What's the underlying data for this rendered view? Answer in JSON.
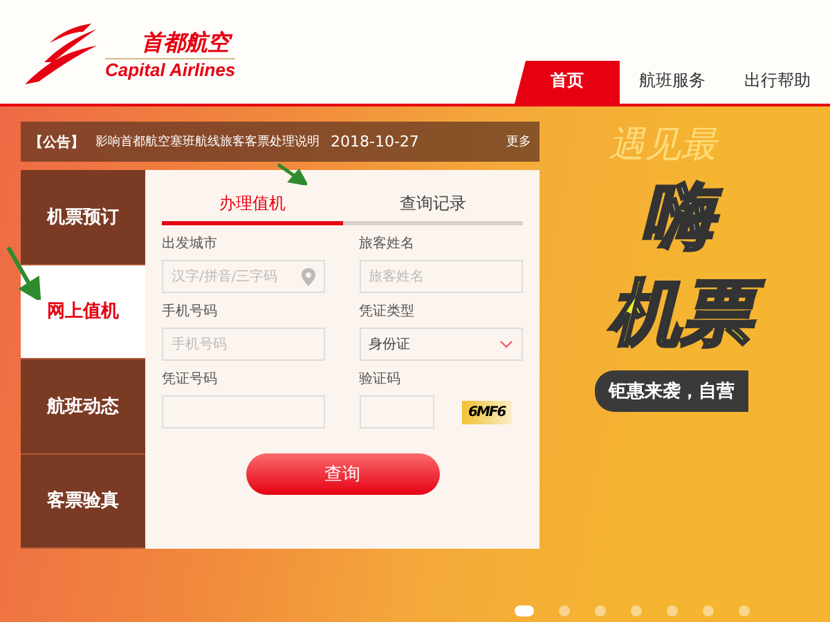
{
  "logo": {
    "chinese": "首都航空",
    "english": "Capital Airlines"
  },
  "nav": [
    {
      "label": "首页",
      "selected": true
    },
    {
      "label": "航班服务",
      "selected": false
    },
    {
      "label": "出行帮助",
      "selected": false
    }
  ],
  "notice": {
    "tag": "【公告】",
    "text": "影响首都航空塞班航线旅客客票处理说明",
    "date": "2018-10-27",
    "more": "更多"
  },
  "side_tabs": [
    {
      "label": "机票预订",
      "selected": false
    },
    {
      "label": "网上值机",
      "selected": true
    },
    {
      "label": "航班动态",
      "selected": false
    },
    {
      "label": "客票验真",
      "selected": false
    }
  ],
  "form_tabs": [
    {
      "label": "办理值机",
      "selected": true
    },
    {
      "label": "查询记录",
      "selected": false
    }
  ],
  "fields": [
    {
      "kind": "city",
      "label": "出发城市",
      "placeholder": "汉字/拼音/三字码"
    },
    {
      "kind": "text",
      "label": "旅客姓名",
      "placeholder": "旅客姓名"
    },
    {
      "kind": "text",
      "label": "手机号码",
      "placeholder": "手机号码"
    },
    {
      "kind": "select",
      "label": "凭证类型",
      "value": "身份证"
    },
    {
      "kind": "text",
      "label": "凭证号码"
    },
    {
      "kind": "captcha",
      "label": "验证码",
      "captcha": "6MF6"
    }
  ],
  "submit": "查询",
  "banner": {
    "script": "遇见最",
    "headline_1": "嗨",
    "headline_2": "机票",
    "subtitle": "钜惠来袭，自营"
  },
  "carousel_dots": [
    {
      "selected": true
    },
    {
      "selected": false
    },
    {
      "selected": false
    },
    {
      "selected": false
    },
    {
      "selected": false
    },
    {
      "selected": false
    },
    {
      "selected": false
    }
  ]
}
